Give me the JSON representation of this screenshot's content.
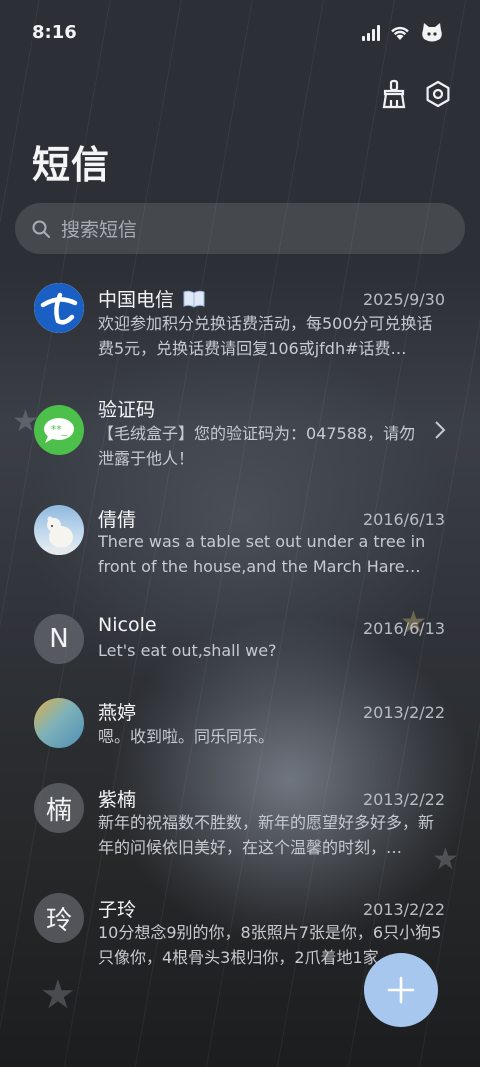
{
  "status_bar": {
    "time": "8:16"
  },
  "header": {
    "title": "短信"
  },
  "search": {
    "placeholder": "搜索短信"
  },
  "messages": [
    {
      "name": "中国电信",
      "date": "2025/9/30",
      "preview": "欢迎参加积分兑换话费活动，每500分可兑换话费5元，兑换话费请回复106或jfdh#话费…",
      "avatar": "china-telecom-logo"
    },
    {
      "name": "验证码",
      "date": "",
      "preview": "【毛绒盒子】您的验证码为：047588，请勿泄露于他人！",
      "avatar": "verification-code-icon"
    },
    {
      "name": "倩倩",
      "date": "2016/6/13",
      "preview": "There was a table set out under a tree in front of the house,and the March Hare an…",
      "avatar": "polar-bear-photo"
    },
    {
      "name": "Nicole",
      "date": "2016/6/13",
      "preview": "Let's eat out,shall we?",
      "avatar_letter": "N"
    },
    {
      "name": "燕婷",
      "date": "2013/2/22",
      "preview": "嗯。收到啦。同乐同乐。",
      "avatar": "landscape-photo"
    },
    {
      "name": "紫楠",
      "date": "2013/2/22",
      "preview": "新年的祝福数不胜数，新年的愿望好多好多，新年的问候依旧美好，在这个温馨的时刻，…",
      "avatar_letter": "楠"
    },
    {
      "name": "子玲",
      "date": "2013/2/22",
      "preview": "10分想念9别的你，8张照片7张是你，6只小狗5只像你，4根骨头3根归你，2爪着地1家…",
      "avatar_letter": "玲"
    }
  ],
  "colors": {
    "fab": "#a7c7ef",
    "telecom_blue": "#1a5fc4",
    "green": "#4cc04a"
  }
}
